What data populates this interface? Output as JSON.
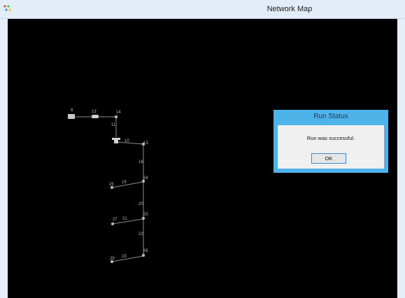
{
  "window": {
    "title": "Network Map"
  },
  "map": {
    "node_labels": [
      "8",
      "13",
      "14",
      "11",
      "10",
      "13",
      "16",
      "19",
      "25",
      "24",
      "20",
      "21",
      "27",
      "25",
      "22",
      "23",
      "29",
      "26"
    ]
  },
  "dialog": {
    "title": "Run Status",
    "message": "Run was successful.",
    "ok_label": "OK"
  }
}
